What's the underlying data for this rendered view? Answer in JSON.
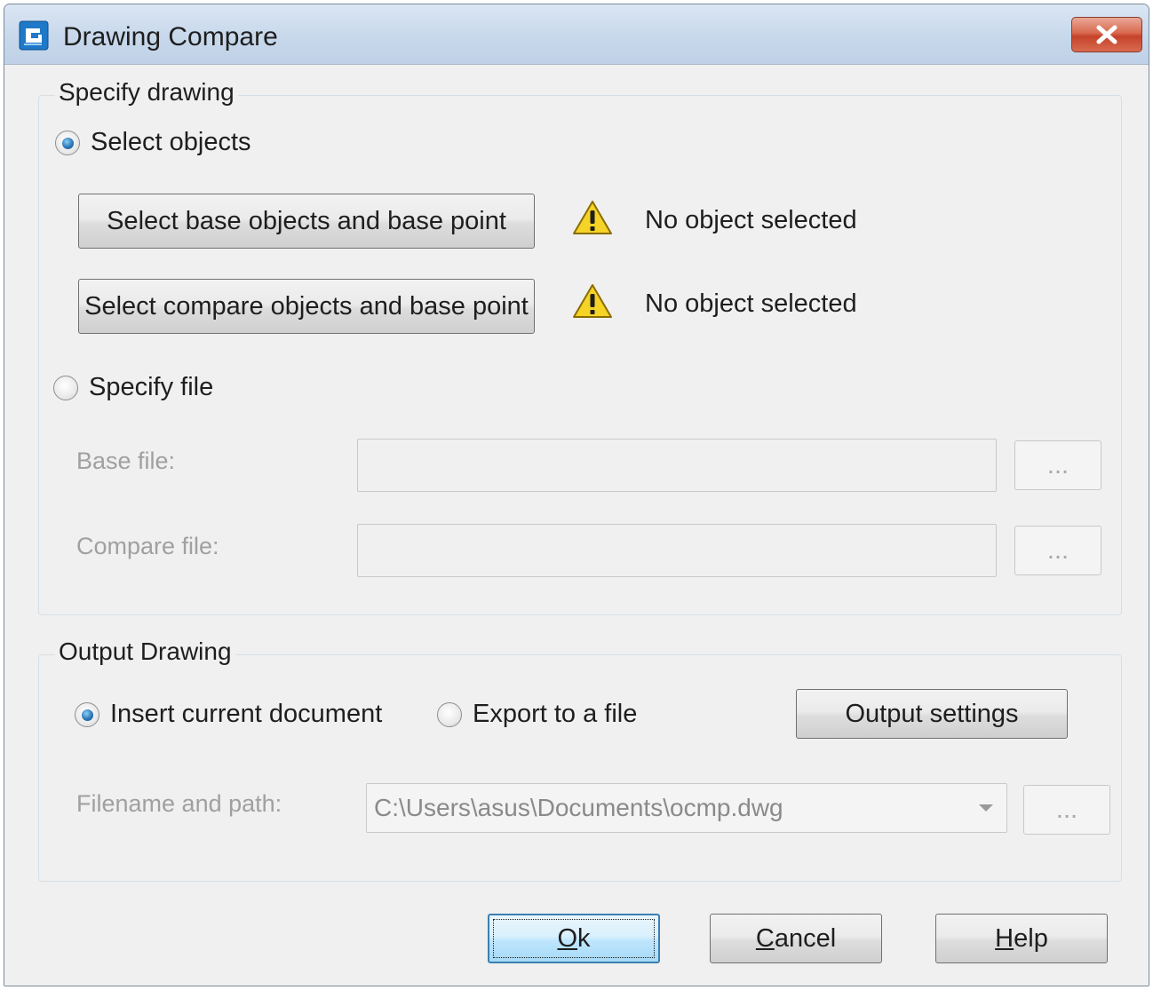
{
  "window": {
    "title": "Drawing Compare",
    "close_label": "✕"
  },
  "specify_drawing": {
    "legend": "Specify drawing",
    "select_objects_label": "Select objects",
    "select_objects_checked": true,
    "base_button_label": "Select base objects and base point",
    "compare_button_label": "Select compare objects and base point",
    "base_status": "No object selected",
    "compare_status": "No object selected",
    "specify_file_label": "Specify file",
    "specify_file_checked": false,
    "base_file_label": "Base file:",
    "base_file_value": "",
    "compare_file_label": "Compare file:",
    "compare_file_value": "",
    "browse_label": "..."
  },
  "output_drawing": {
    "legend": "Output Drawing",
    "insert_current_label": "Insert current document",
    "insert_current_checked": true,
    "export_file_label": "Export to a file",
    "export_file_checked": false,
    "output_settings_label": "Output settings",
    "filename_label": "Filename and path:",
    "filename_value": "C:\\Users\\asus\\Documents\\ocmp.dwg",
    "browse_label": "..."
  },
  "footer": {
    "ok_label": "Ok",
    "ok_mnemonic": "O",
    "cancel_label": "Cancel",
    "cancel_mnemonic": "C",
    "help_label": "Help",
    "help_mnemonic": "H"
  },
  "colors": {
    "warning": "#f5d327",
    "accent": "#3c7fb1",
    "close": "#c4432a"
  },
  "icons": {
    "app": "gstarcad-icon",
    "close": "close-icon",
    "warning": "warning-icon",
    "dropdown": "chevron-down-icon"
  }
}
